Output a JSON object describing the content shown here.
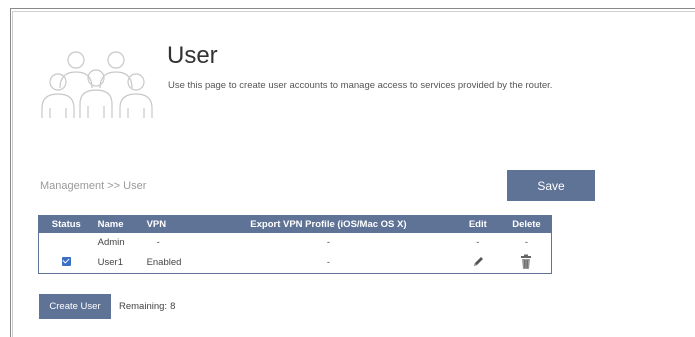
{
  "header": {
    "title": "User",
    "description": "Use this page to create user accounts to manage access to services provided by the router."
  },
  "breadcrumb": "Management >> User",
  "save_label": "Save",
  "table": {
    "columns": [
      "Status",
      "Name",
      "VPN",
      "Export VPN Profile (iOS/Mac OS X)",
      "Edit",
      "Delete"
    ],
    "rows": [
      {
        "status": "",
        "name": "Admin",
        "vpn": "-",
        "export": "-",
        "edit": "-",
        "delete": "-"
      },
      {
        "status": "checked",
        "name": "User1",
        "vpn": "Enabled",
        "export": "-",
        "edit": "pencil-icon",
        "delete": "trash-icon"
      }
    ]
  },
  "create_label": "Create User",
  "remaining": {
    "label": "Remaining:",
    "value": "8"
  },
  "colors": {
    "accent": "#5f7397",
    "checkbox": "#3a6fc4"
  }
}
